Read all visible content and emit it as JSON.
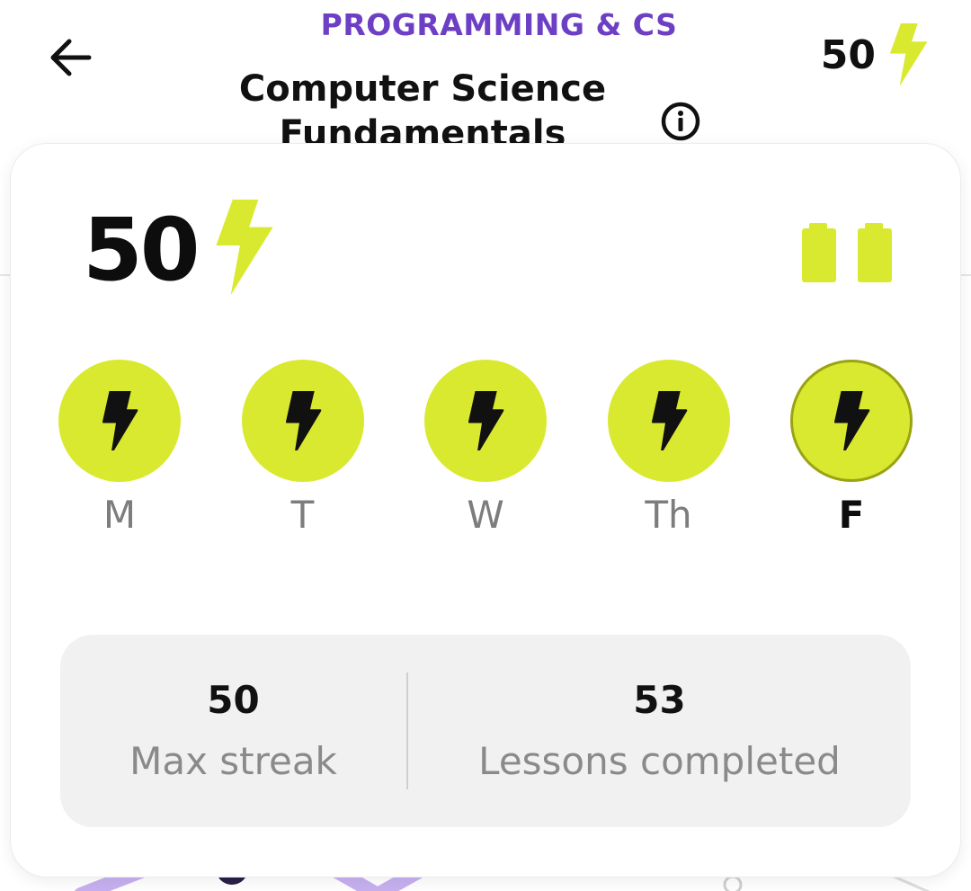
{
  "header": {
    "category": "PROGRAMMING & CS",
    "course_title_line1": "Computer Science",
    "course_title_line2": "Fundamentals",
    "streak_count": "50",
    "icons": {
      "back": "arrow-left-icon",
      "info": "info-icon",
      "streak": "lightning-bolt-icon"
    }
  },
  "streak_card": {
    "current_streak": "50",
    "streak_icon": "lightning-bolt-icon",
    "freeze_icon": "battery-freeze-icon",
    "freeze_count": 2,
    "days": [
      {
        "label": "M",
        "completed": true,
        "today": false
      },
      {
        "label": "T",
        "completed": true,
        "today": false
      },
      {
        "label": "W",
        "completed": true,
        "today": false
      },
      {
        "label": "Th",
        "completed": true,
        "today": false
      },
      {
        "label": "F",
        "completed": true,
        "today": true
      }
    ],
    "stats": {
      "max_streak_value": "50",
      "max_streak_label": "Max streak",
      "lessons_value": "53",
      "lessons_label": "Lessons completed"
    }
  },
  "colors": {
    "accent_lime": "#d9e92f",
    "accent_lime_border": "#9aa312",
    "category_purple": "#6c3fc4",
    "path_lavender": "#c7b0f0",
    "text_dark": "#0d0d0d",
    "text_muted": "#7d7d7d",
    "stats_bg": "#f1f1f1"
  }
}
